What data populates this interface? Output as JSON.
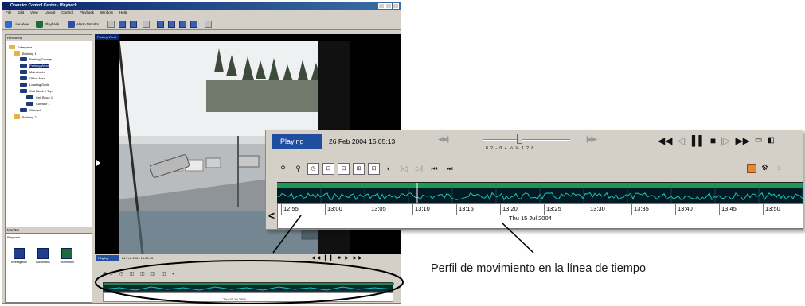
{
  "app": {
    "title": "Operator Control Center - Playback",
    "menu": [
      "File",
      "Edit",
      "View",
      "Layout",
      "Control",
      "Playback",
      "Window",
      "Help"
    ],
    "toolbar": [
      {
        "label": "Live View",
        "icon": "camera-icon",
        "color": "#2a6bd6"
      },
      {
        "label": "Playback",
        "icon": "playback-icon",
        "color": "#1d6a3a"
      },
      {
        "label": "Alarm Monitor",
        "icon": "alarm-icon",
        "color": "#2e4fa3"
      }
    ],
    "left_header": "Hierarchy",
    "tree": [
      {
        "label": "Enterprise",
        "icon": "folder-icon"
      },
      {
        "label": "Building 1",
        "icon": "folder-icon"
      },
      {
        "label": "Parking Garage",
        "icon": "camera-icon"
      },
      {
        "label": "Parking West",
        "icon": "camera-icon",
        "selected": true
      },
      {
        "label": "Main Lobby",
        "icon": "camera-icon"
      },
      {
        "label": "Office Area",
        "icon": "camera-icon"
      },
      {
        "label": "Loading Dock",
        "icon": "camera-icon"
      },
      {
        "label": "Cell Block 1 Top",
        "icon": "camera-icon"
      },
      {
        "label": "Cell Block 1",
        "icon": "camera-icon"
      },
      {
        "label": "Corridor 1",
        "icon": "camera-icon"
      },
      {
        "label": "Stairwell",
        "icon": "camera-icon"
      },
      {
        "label": "Building 2",
        "icon": "folder-icon"
      }
    ],
    "tools_header": "Monitor",
    "tools_sub": "Playback",
    "tools": [
      "Investigation",
      "Bookmarks",
      "Thumbnails"
    ],
    "video_caption": "Parking West",
    "small_status": "Playing",
    "small_date": "26 Feb 2004 15:05:13",
    "small_day": "Thu 15 Jul 2004"
  },
  "zoom": {
    "status": "Playing",
    "datetime": "26 Feb 2004 15:05:13",
    "speeds": "8  2  -  0  +  ¼  ½  1  2  8",
    "times": [
      "12:55",
      "13:00",
      "13:05",
      "13:10",
      "13:15",
      "13:20",
      "13:25",
      "13:30",
      "13:35",
      "13:40",
      "13:45",
      "13:50"
    ],
    "day": "Thu 15 Jul 2004"
  },
  "annotation": {
    "caption": "Perfil de movimiento en la línea de tiempo"
  },
  "colors": {
    "status_bg": "#1f4ea0",
    "motion_bg": "#031a22",
    "motion_line": "#1bc4c0",
    "accent_window": "#0a246a"
  }
}
